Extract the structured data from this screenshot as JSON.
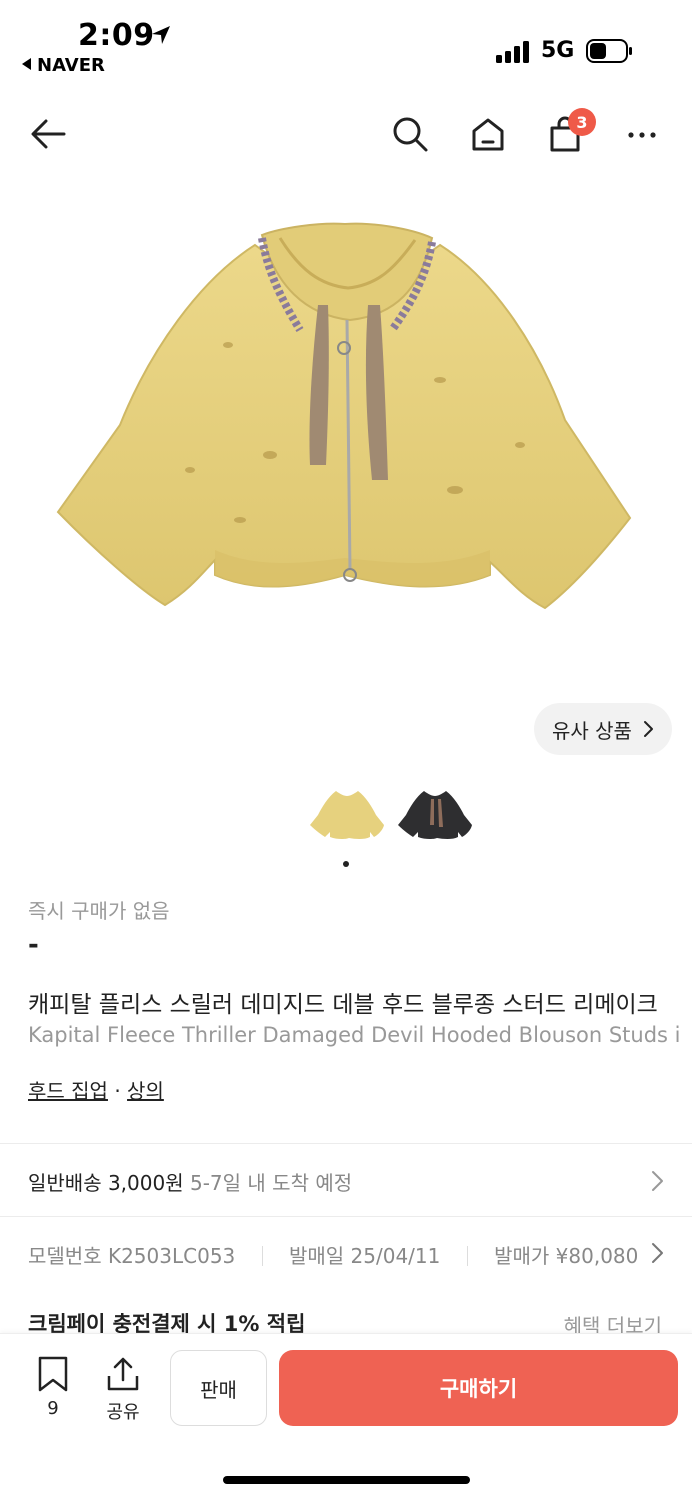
{
  "status_bar": {
    "time": "2:09",
    "back_app": "NAVER",
    "network": "5G"
  },
  "nav": {
    "cart_count": "3"
  },
  "product": {
    "similar_label": "유사 상품",
    "instant_price_label": "즉시 구매가 없음",
    "price": "-",
    "name_ko": "캐피탈 플리스 스릴러 데미지드 데블 후드 블루종 스터드 리메이크",
    "name_en": "Kapital Fleece Thriller Damaged Devil Hooded Blouson Studs i",
    "category_1": "후드 집업",
    "category_sep": "·",
    "category_2": "상의"
  },
  "shipping": {
    "label": "일반배송 3,000원",
    "eta": "5-7일 내 도착 예정"
  },
  "specs": {
    "model_label": "모델번호",
    "model_value": "K2503LC053",
    "release_label": "발매일",
    "release_value": "25/04/11",
    "price_label": "발매가",
    "price_value": "¥80,080"
  },
  "promo": {
    "text": "크림페이 충전결제 시 1% 적립",
    "more": "혜택 더보기"
  },
  "bottom_bar": {
    "bookmark_count": "9",
    "share_label": "공유",
    "sell_label": "판매",
    "buy_label": "구매하기"
  },
  "colors": {
    "accent": "#ef6253",
    "badge": "#ef5a48",
    "jacket": "#e6d17e"
  }
}
